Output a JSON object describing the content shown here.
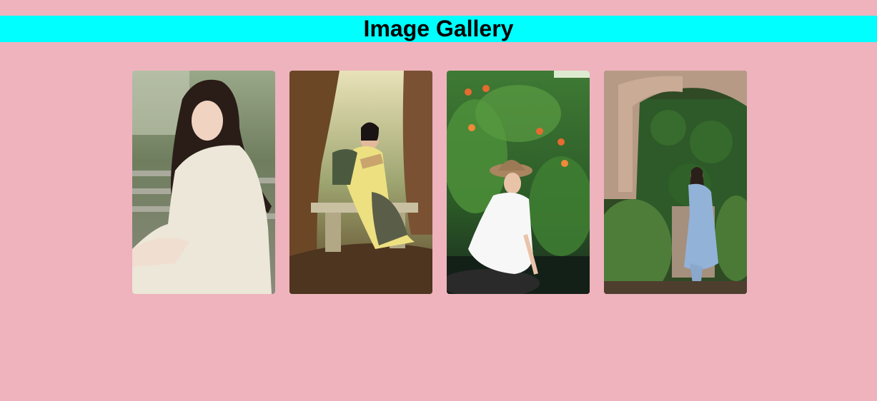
{
  "header": {
    "title": "Image Gallery",
    "background": "#00ffff"
  },
  "page": {
    "background": "#eeb3bd"
  },
  "gallery": {
    "images": [
      {
        "name": "photo-woman-white-dress-stairs",
        "description_icon": "photo-icon"
      },
      {
        "name": "photo-woman-reading-bench",
        "description_icon": "photo-icon"
      },
      {
        "name": "photo-woman-hat-pond",
        "description_icon": "photo-icon"
      },
      {
        "name": "photo-woman-ruins-archway",
        "description_icon": "photo-icon"
      }
    ]
  }
}
